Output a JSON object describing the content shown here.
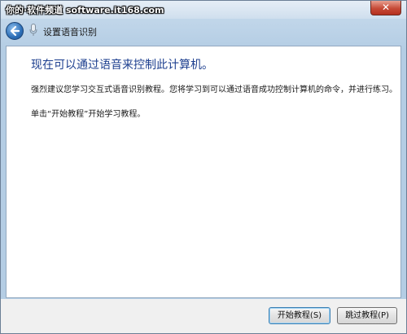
{
  "titlebar": {
    "watermark": "你的·软件频道 software.it168.com",
    "close_label": "✕"
  },
  "nav": {
    "title": "设置语音识别"
  },
  "content": {
    "heading": "现在可以通过语音来控制此计算机。",
    "para1": "强烈建议您学习交互式语音识别教程。您将学习到可以通过语音成功控制计算机的命令，并进行练习。",
    "para2": "单击“开始教程”开始学习教程。"
  },
  "buttons": {
    "start": "开始教程(S)",
    "skip": "跳过教程(P)"
  },
  "colors": {
    "heading": "#1d3f8f",
    "close_button": "#c64a37",
    "back_button": "#2d6fb7"
  },
  "icons": {
    "back": "arrow-left-icon",
    "mic": "microphone-icon",
    "close": "close-icon"
  }
}
